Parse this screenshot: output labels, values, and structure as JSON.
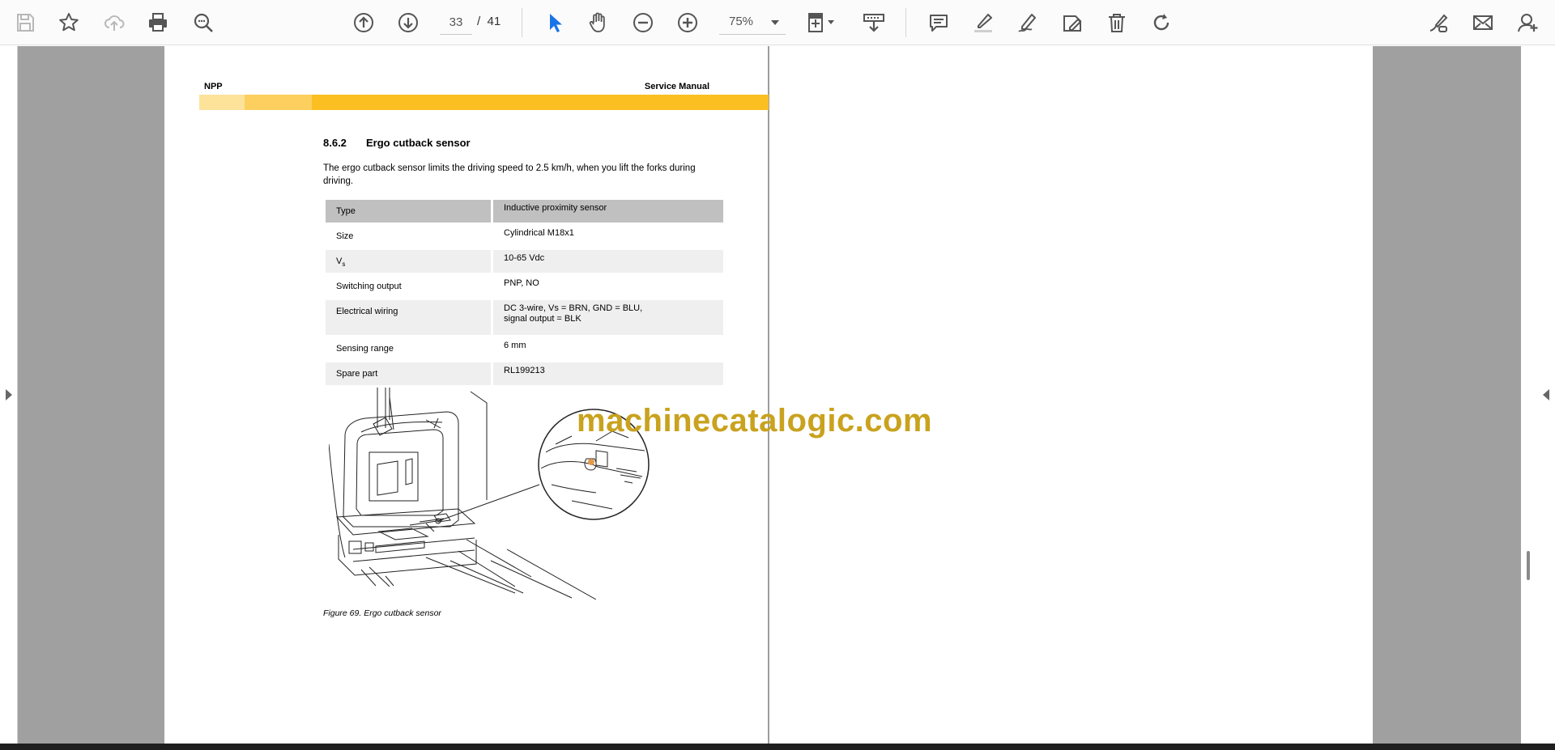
{
  "toolbar": {
    "page_current": "33",
    "page_separator": "/",
    "page_total": "41",
    "zoom": "75%"
  },
  "document": {
    "header_left": "NPP",
    "header_right": "Service Manual",
    "section_number": "8.6.2",
    "section_title": "Ergo cutback sensor",
    "intro": "The ergo cutback sensor limits the driving speed to 2.5 km/h, when you lift the forks during driving.",
    "spec_rows": [
      {
        "key": "Type",
        "value": "Inductive proximity sensor"
      },
      {
        "key": "Size",
        "value": "Cylindrical M18x1"
      },
      {
        "key": "V",
        "key_sub": "s",
        "value": "10-65 Vdc"
      },
      {
        "key": "Switching output",
        "value": "PNP, NO"
      },
      {
        "key": "Electrical wiring",
        "value": "DC 3-wire, Vs = BRN, GND = BLU,",
        "value_line2": "signal output = BLK"
      },
      {
        "key": "Sensing range",
        "value": "6 mm"
      },
      {
        "key": "Spare part",
        "value": "RL199213"
      }
    ],
    "figure_caption": "Figure 69. Ergo cutback sensor"
  },
  "watermark": "machinecatalogic.com",
  "colors": {
    "band": "#fbbf22",
    "watermark": "#c9a21e",
    "select_tool": "#1a73e8"
  },
  "icons": [
    "save-icon",
    "bookmark-star-icon",
    "upload-cloud-icon",
    "print-icon",
    "zoom-search-icon",
    "page-up-icon",
    "page-down-icon",
    "select-cursor-icon",
    "hand-tool-icon",
    "zoom-out-icon",
    "zoom-in-icon",
    "fit-page-icon",
    "read-mode-icon",
    "comment-icon",
    "highlight-icon",
    "draw-icon",
    "stamp-icon",
    "delete-icon",
    "rotate-icon",
    "fill-sign-icon",
    "email-icon",
    "share-user-icon"
  ]
}
